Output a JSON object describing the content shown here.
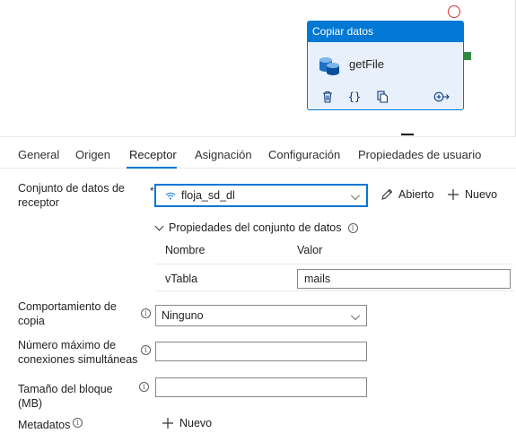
{
  "activity": {
    "type_label": "Copiar datos",
    "name": "getFile",
    "actions": [
      "delete-icon",
      "code-icon",
      "copy-icon",
      "add-output-icon"
    ]
  },
  "tabs": [
    {
      "label": "General"
    },
    {
      "label": "Origen"
    },
    {
      "label": "Receptor",
      "active": true
    },
    {
      "label": "Asignación"
    },
    {
      "label": "Configuración"
    },
    {
      "label": "Propiedades de usuario"
    }
  ],
  "form": {
    "dataset": {
      "label": "Conjunto de datos de receptor",
      "required_mark": "*",
      "value": "floja_sd_dl",
      "open_label": "Abierto",
      "new_label": "Nuevo"
    },
    "dataset_props": {
      "header": "Propiedades del conjunto de datos",
      "col_name": "Nombre",
      "col_value": "Valor",
      "rows": [
        {
          "name": "vTabla",
          "value": "mails"
        }
      ]
    },
    "copy_behavior": {
      "label": "Comportamiento de copia",
      "value": "Ninguno"
    },
    "max_connections": {
      "label": "Número máximo de conexiones simultáneas",
      "value": ""
    },
    "block_size": {
      "label": "Tamaño del bloque (MB)",
      "value": ""
    },
    "metadata": {
      "label": "Metadatos",
      "new_label": "Nuevo"
    }
  },
  "colors": {
    "accent": "#0078d4",
    "activity_body": "#e8f1fb",
    "error_ring": "#d13438",
    "success_port": "#2e8b3e"
  }
}
